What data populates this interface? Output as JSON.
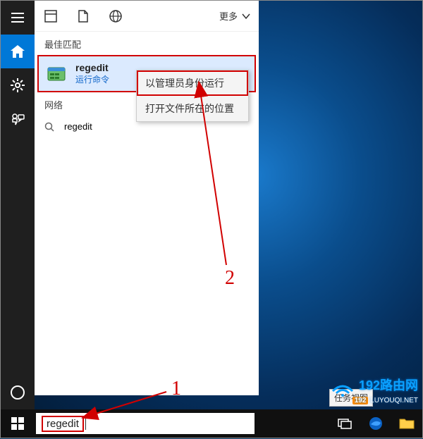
{
  "rail": {
    "menu": "menu",
    "home": "home",
    "settings": "settings",
    "feedback": "feedback"
  },
  "panel": {
    "more": "更多",
    "best_match": "最佳匹配",
    "result_title": "regedit",
    "result_sub": "运行命令",
    "web_header": "网络",
    "web_result": "regedit"
  },
  "context": {
    "run_admin": "以管理员身份运行",
    "open_location": "打开文件所在的位置"
  },
  "taskbar": {
    "search_value": "regedit",
    "taskview_tooltip": "任务视图"
  },
  "anno": {
    "n1": "1",
    "n2": "2"
  },
  "watermark": {
    "brand": "192路由网",
    "url": "LUYOUQI.NET",
    "num": "192"
  }
}
